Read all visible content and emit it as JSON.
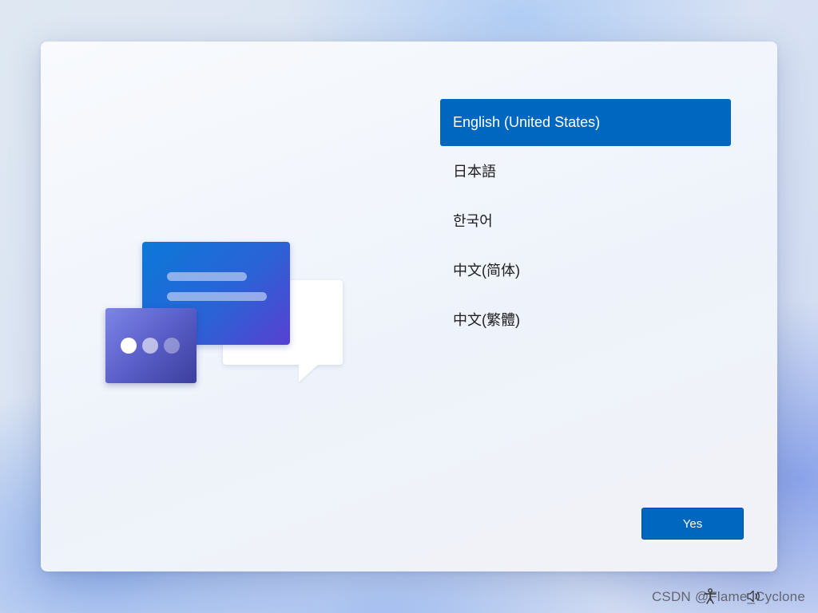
{
  "languages": [
    {
      "label": "English (United States)",
      "selected": true
    },
    {
      "label": "日本語",
      "selected": false
    },
    {
      "label": "한국어",
      "selected": false
    },
    {
      "label": "中文(简体)",
      "selected": false
    },
    {
      "label": "中文(繁體)",
      "selected": false
    }
  ],
  "yes_button": {
    "label": "Yes"
  },
  "tray": {
    "icons": [
      "accessibility-icon",
      "volume-icon"
    ]
  },
  "watermark": "CSDN @Flame_Cyclone",
  "colors": {
    "accent": "#0067c0",
    "illustration_blue": "#2a63d6",
    "illustration_purple": "#5a5fc9"
  }
}
